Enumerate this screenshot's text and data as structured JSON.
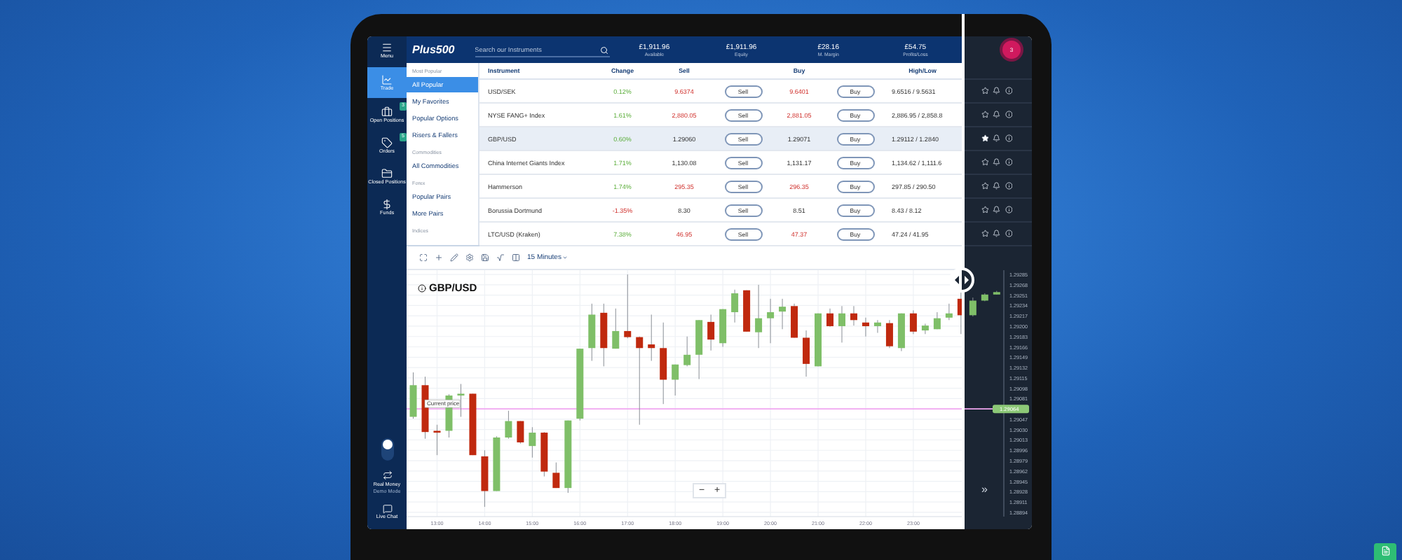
{
  "sidebar": {
    "items": [
      {
        "label": "Menu",
        "kind": "menu",
        "selected": false
      },
      {
        "label": "Trade",
        "kind": "trade",
        "selected": true
      },
      {
        "label": "Open Positions",
        "kind": "positions",
        "selected": false,
        "badge": "3"
      },
      {
        "label": "Orders",
        "kind": "orders",
        "selected": false,
        "badge": "5"
      },
      {
        "label": "Closed Positions",
        "kind": "closed",
        "selected": false
      },
      {
        "label": "Funds",
        "kind": "funds",
        "selected": false
      }
    ],
    "dark_mode": {
      "on": true
    },
    "account_switch": {
      "label": "Real Money",
      "sublabel": "Demo Mode",
      "demo": false
    },
    "chat": {
      "label": "Live Chat"
    }
  },
  "header": {
    "logo": "Plus500",
    "search": {
      "placeholder": "Search our Instruments"
    },
    "stats": [
      {
        "value": "£1,911.96",
        "label": "Available"
      },
      {
        "value": "£1,911.96",
        "label": "Equity"
      },
      {
        "value": "£28.16",
        "label": "M. Margin"
      },
      {
        "value": "£54.75",
        "label": "Profits/Loss"
      }
    ],
    "notifications": "3"
  },
  "menu": {
    "sections": [
      {
        "heading": "Most Popular",
        "items": [
          {
            "label": "All Popular",
            "selected": true
          },
          {
            "label": "My Favorites",
            "selected": false
          },
          {
            "label": "Popular Options",
            "selected": false
          },
          {
            "label": "Risers & Fallers",
            "selected": false
          }
        ]
      },
      {
        "heading": "Commodities",
        "items": [
          {
            "label": "All Commodities",
            "selected": false
          }
        ]
      },
      {
        "heading": "Forex",
        "items": [
          {
            "label": "Popular Pairs",
            "selected": false
          },
          {
            "label": "More Pairs",
            "selected": false
          }
        ]
      },
      {
        "heading": "Indices"
      }
    ]
  },
  "table": {
    "columns": [
      "Instrument",
      "Change",
      "Sell",
      "Buy",
      "High/Low"
    ],
    "rows": [
      {
        "instrument": "USD/SEK",
        "change": "0.12%",
        "falling": false,
        "sell": "9.6374",
        "buy": "9.6401",
        "prices_falling": true,
        "sell_button": "Sell",
        "buy_button": "Buy",
        "high_low": "9.6516 / 9.5631",
        "selected": false,
        "favorite": false
      },
      {
        "instrument": "NYSE FANG+ Index",
        "change": "1.61%",
        "falling": false,
        "sell": "2,880.05",
        "buy": "2,881.05",
        "prices_falling": true,
        "sell_button": "Sell",
        "buy_button": "Buy",
        "high_low": "2,886.95 / 2,858.8",
        "selected": false,
        "favorite": false
      },
      {
        "instrument": "GBP/USD",
        "change": "0.60%",
        "falling": false,
        "sell": "1.29060",
        "buy": "1.29071",
        "prices_falling": false,
        "sell_button": "Sell",
        "buy_button": "Buy",
        "high_low": "1.29112 / 1.2840",
        "selected": true,
        "favorite": true
      },
      {
        "instrument": "China Internet Giants Index",
        "change": "1.71%",
        "falling": false,
        "sell": "1,130.08",
        "buy": "1,131.17",
        "prices_falling": false,
        "sell_button": "Sell",
        "buy_button": "Buy",
        "high_low": "1,134.62 / 1,111.6",
        "selected": false,
        "favorite": false
      },
      {
        "instrument": "Hammerson",
        "change": "1.74%",
        "falling": false,
        "sell": "295.35",
        "buy": "296.35",
        "prices_falling": true,
        "sell_button": "Sell",
        "buy_button": "Buy",
        "high_low": "297.85 / 290.50",
        "selected": false,
        "favorite": false
      },
      {
        "instrument": "Borussia Dortmund",
        "change": "-1.35%",
        "falling": true,
        "sell": "8.30",
        "buy": "8.51",
        "prices_falling": false,
        "sell_button": "Sell",
        "buy_button": "Buy",
        "high_low": "8.43 / 8.12",
        "selected": false,
        "favorite": false
      },
      {
        "instrument": "LTC/USD (Kraken)",
        "change": "7.38%",
        "falling": false,
        "sell": "46.95",
        "buy": "47.37",
        "prices_falling": true,
        "sell_button": "Sell",
        "buy_button": "Buy",
        "high_low": "47.24 / 41.95",
        "selected": false,
        "favorite": false
      }
    ]
  },
  "chart": {
    "interval": "15 Minutes",
    "title": "GBP/USD",
    "current_price": "1.29064",
    "zoom_out": "−",
    "zoom_in": "+",
    "scroll_end": "»",
    "chart_data": {
      "type": "candlestick",
      "x": [
        12.5,
        12.75,
        13,
        13.25,
        13.5,
        13.75,
        14,
        14.25,
        14.5,
        14.75,
        15,
        15.25,
        15.5,
        15.75,
        16,
        16.25,
        16.5,
        16.75,
        17,
        17.25,
        17.5,
        17.75,
        18,
        18.25,
        18.5,
        18.75,
        19,
        19.25,
        19.5,
        19.75,
        20,
        20.25,
        20.5,
        20.75,
        21,
        21.25,
        21.5,
        21.75,
        22,
        22.25,
        22.5,
        22.75,
        23,
        23.25,
        23.5,
        23.75,
        24,
        24.25,
        24.5,
        24.75
      ],
      "xlim": [
        12.36,
        24.9
      ],
      "ylim": [
        1.28887,
        1.29292
      ],
      "grid": true,
      "ref_lines": [
        {
          "axis": "y",
          "value": 1.29064,
          "label": "Current price"
        }
      ],
      "ohlc": [
        [
          1.29051,
          1.29124,
          1.29048,
          1.29103
        ],
        [
          1.29103,
          1.29117,
          1.29015,
          1.29026
        ],
        [
          1.29028,
          1.29038,
          1.28988,
          1.29025
        ],
        [
          1.29028,
          1.29088,
          1.29017,
          1.29086
        ],
        [
          1.29086,
          1.29105,
          1.29051,
          1.29089
        ],
        [
          1.29089,
          1.29089,
          1.28988,
          1.28988
        ],
        [
          1.28986,
          1.28996,
          1.28903,
          1.28929
        ],
        [
          1.28929,
          1.29019,
          1.28929,
          1.29017
        ],
        [
          1.29017,
          1.29061,
          1.29015,
          1.29044
        ],
        [
          1.29044,
          1.29044,
          1.29007,
          1.29009
        ],
        [
          1.29003,
          1.29034,
          1.28984,
          1.29025
        ],
        [
          1.29025,
          1.29026,
          1.28953,
          1.28961
        ],
        [
          1.28959,
          1.28976,
          1.28934,
          1.28934
        ],
        [
          1.28934,
          1.29045,
          1.28926,
          1.29045
        ],
        [
          1.29048,
          1.29163,
          1.29045,
          1.29163
        ],
        [
          1.29164,
          1.29237,
          1.29143,
          1.29219
        ],
        [
          1.29222,
          1.29237,
          1.29134,
          1.29164
        ],
        [
          1.29163,
          1.29229,
          1.29163,
          1.29192
        ],
        [
          1.29192,
          1.29285,
          1.2918,
          1.29182
        ],
        [
          1.29182,
          1.29183,
          1.29038,
          1.29164
        ],
        [
          1.2917,
          1.29219,
          1.29143,
          1.29164
        ],
        [
          1.29164,
          1.29206,
          1.29072,
          1.29112
        ],
        [
          1.29112,
          1.29137,
          1.29086,
          1.29137
        ],
        [
          1.29136,
          1.29183,
          1.29134,
          1.29153
        ],
        [
          1.29153,
          1.2921,
          1.29113,
          1.2921
        ],
        [
          1.29207,
          1.29219,
          1.2916,
          1.29178
        ],
        [
          1.29172,
          1.29228,
          1.29166,
          1.29228
        ],
        [
          1.29223,
          1.2926,
          1.29206,
          1.29254
        ],
        [
          1.29259,
          1.29259,
          1.29191,
          1.29191
        ],
        [
          1.2919,
          1.29268,
          1.29164,
          1.29213
        ],
        [
          1.29213,
          1.29245,
          1.29172,
          1.29223
        ],
        [
          1.29224,
          1.29245,
          1.29195,
          1.29232
        ],
        [
          1.29233,
          1.29237,
          1.29181,
          1.29181
        ],
        [
          1.29181,
          1.29193,
          1.29117,
          1.29138
        ],
        [
          1.29134,
          1.29221,
          1.29134,
          1.29221
        ],
        [
          1.29221,
          1.29229,
          1.29199,
          1.292
        ],
        [
          1.292,
          1.29233,
          1.29173,
          1.29221
        ],
        [
          1.29221,
          1.29233,
          1.29201,
          1.2921
        ],
        [
          1.29206,
          1.29214,
          1.29183,
          1.292
        ],
        [
          1.292,
          1.2921,
          1.29189,
          1.29206
        ],
        [
          1.29205,
          1.2921,
          1.29164,
          1.29167
        ],
        [
          1.29164,
          1.29221,
          1.29159,
          1.29221
        ],
        [
          1.29221,
          1.29226,
          1.29187,
          1.29191
        ],
        [
          1.29193,
          1.29204,
          1.29187,
          1.29201
        ],
        [
          1.29195,
          1.29223,
          1.29195,
          1.29213
        ],
        [
          1.29214,
          1.29237,
          1.2921,
          1.29221
        ],
        [
          1.29245,
          1.29256,
          1.29187,
          1.29218
        ],
        [
          1.29218,
          1.29247,
          1.29216,
          1.29242
        ],
        [
          1.29242,
          1.29254,
          1.29241,
          1.29252
        ],
        [
          1.29252,
          1.29258,
          1.29252,
          1.29256
        ]
      ],
      "yticks": [
        {
          "value": 1.29285,
          "label": "1.29285"
        },
        {
          "value": 1.29268,
          "label": "1.29268"
        },
        {
          "value": 1.29251,
          "label": "1.29251"
        },
        {
          "value": 1.29234,
          "label": "1.29234"
        },
        {
          "value": 1.29217,
          "label": "1.29217"
        },
        {
          "value": 1.292,
          "label": "1.29200"
        },
        {
          "value": 1.29183,
          "label": "1.29183"
        },
        {
          "value": 1.29166,
          "label": "1.29166"
        },
        {
          "value": 1.29149,
          "label": "1.29149"
        },
        {
          "value": 1.29132,
          "label": "1.29132"
        },
        {
          "value": 1.29115,
          "label": "1.29115"
        },
        {
          "value": 1.29098,
          "label": "1.29098"
        },
        {
          "value": 1.29081,
          "label": "1.29081"
        },
        {
          "value": 1.29047,
          "label": "1.29047"
        },
        {
          "value": 1.2903,
          "label": "1.29030"
        },
        {
          "value": 1.29013,
          "label": "1.29013"
        },
        {
          "value": 1.28996,
          "label": "1.28996"
        },
        {
          "value": 1.28979,
          "label": "1.28979"
        },
        {
          "value": 1.28962,
          "label": "1.28962"
        },
        {
          "value": 1.28945,
          "label": "1.28945"
        },
        {
          "value": 1.28928,
          "label": "1.28928"
        },
        {
          "value": 1.28911,
          "label": "1.28911"
        },
        {
          "value": 1.28894,
          "label": "1.28894"
        }
      ],
      "xticks": [
        {
          "value": 13,
          "label": "13:00"
        },
        {
          "value": 14,
          "label": "14:00"
        },
        {
          "value": 15,
          "label": "15:00"
        },
        {
          "value": 16,
          "label": "16:00"
        },
        {
          "value": 17,
          "label": "17:00"
        },
        {
          "value": 18,
          "label": "18:00"
        },
        {
          "value": 19,
          "label": "19:00"
        },
        {
          "value": 20,
          "label": "20:00"
        },
        {
          "value": 21,
          "label": "21:00"
        },
        {
          "value": 22,
          "label": "22:00"
        },
        {
          "value": 23,
          "label": "23:00"
        }
      ]
    }
  }
}
